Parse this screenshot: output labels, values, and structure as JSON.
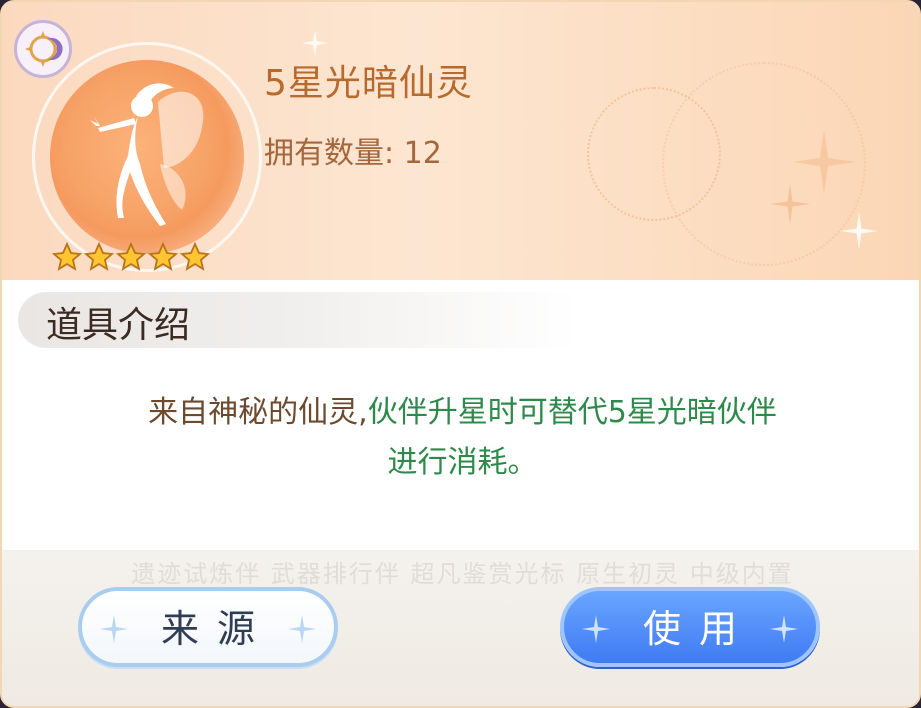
{
  "item": {
    "name": "5星光暗仙灵",
    "count_label": "拥有数量:",
    "count_value": "12",
    "rarity_stars": 5
  },
  "section": {
    "title": "道具介绍"
  },
  "description": {
    "part1": "来自神秘的仙灵,",
    "part2": "伙伴升星时可替代5星光暗伙伴",
    "part3": "进行消耗。"
  },
  "buttons": {
    "source": "来源",
    "use": "使用"
  },
  "background_text": "遗迹试炼伴 武器排行伴 超凡鉴赏光标 原生初灵 中级内置",
  "colors": {
    "accent": "#f59a5f",
    "title": "#b86a2e",
    "highlight": "#2e8a4a",
    "button_primary": "#3f7bf3"
  },
  "icons": {
    "element_badge": "moon-sun-icon",
    "portrait": "fairy-silhouette-icon",
    "star": "star-icon"
  }
}
